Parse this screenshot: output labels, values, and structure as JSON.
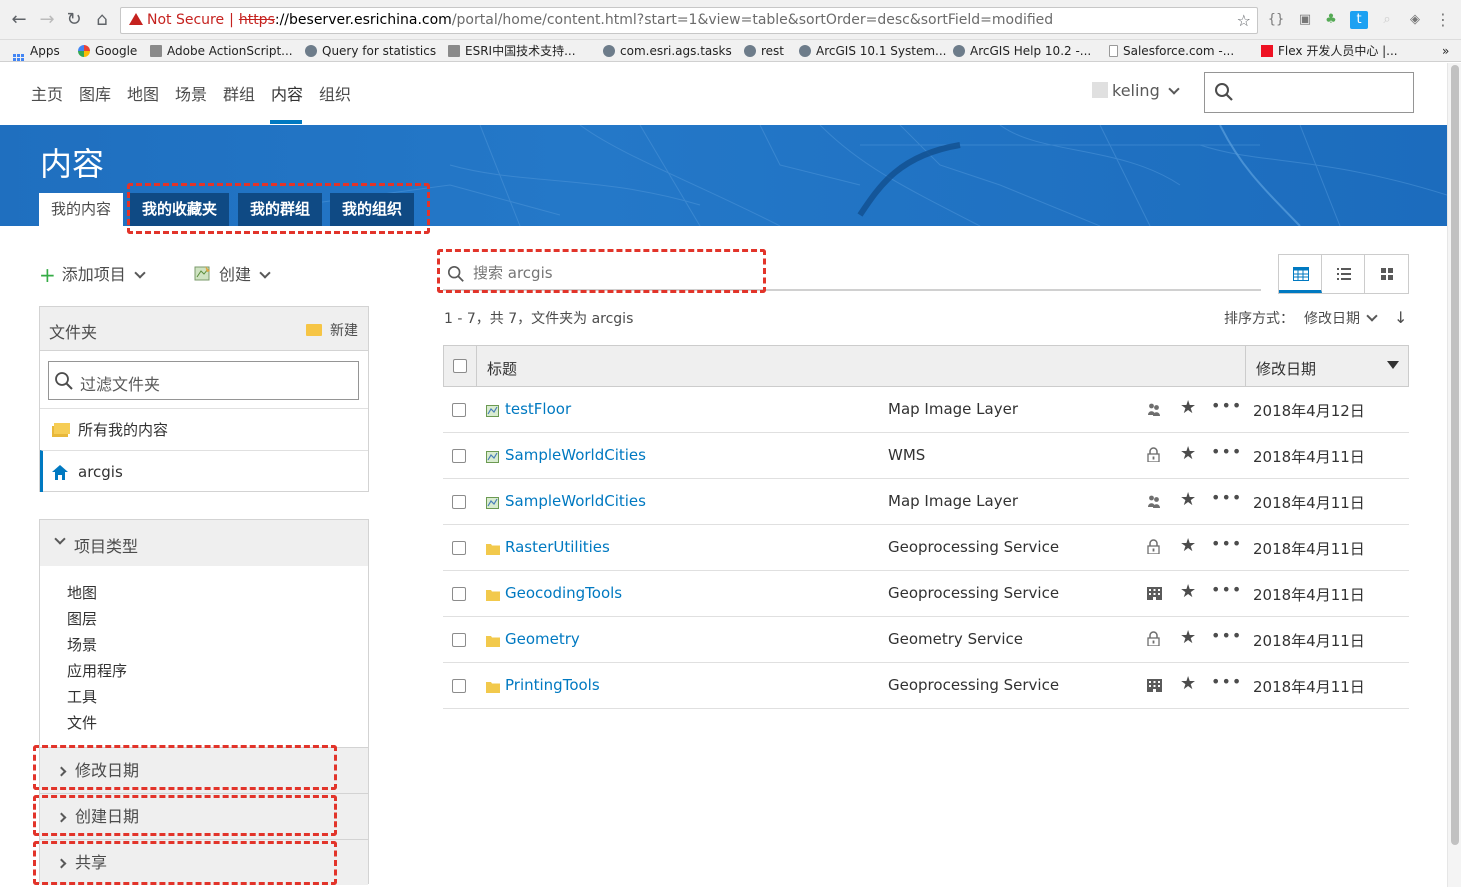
{
  "browser": {
    "not_secure": "Not Secure",
    "url_scheme": "https",
    "url_sep": "|",
    "url_host": "://beserver.esrichina.com",
    "url_path": "/portal/home/content.html?start=1&view=table&sortOrder=desc&sortField=modified",
    "bookmarks": [
      "Apps",
      "Google",
      "Adobe ActionScript...",
      "Query for statistics",
      "ESRI中国技术支持...",
      "com.esri.ags.tasks",
      "rest",
      "ArcGIS 10.1 System...",
      "ArcGIS Help 10.2 -...",
      "Salesforce.com -...",
      "Flex 开发人员中心 |..."
    ],
    "more": "»"
  },
  "nav": {
    "items": [
      "主页",
      "图库",
      "地图",
      "场景",
      "群组",
      "内容",
      "组织"
    ],
    "active": "内容",
    "username": "keling"
  },
  "banner": {
    "title": "内容",
    "tabs": [
      "我的内容",
      "我的收藏夹",
      "我的群组",
      "我的组织"
    ]
  },
  "actions": {
    "add": "添加项目",
    "create": "创建"
  },
  "folders": {
    "header": "文件夹",
    "new": "新建",
    "filter_placeholder": "过滤文件夹",
    "items": [
      "所有我的内容",
      "arcgis"
    ]
  },
  "filters": {
    "type_header": "项目类型",
    "types": [
      "地图",
      "图层",
      "场景",
      "应用程序",
      "工具",
      "文件"
    ],
    "modified": "修改日期",
    "created": "创建日期",
    "shared": "共享"
  },
  "search": {
    "placeholder": "搜索 arcgis"
  },
  "results": {
    "count": "1 - 7，共 7，文件夹为 arcgis",
    "sort_label": "排序方式：",
    "sort_field": "修改日期",
    "col_title": "标题",
    "col_date": "修改日期",
    "rows": [
      {
        "name": "testFloor",
        "type": "Map Image Layer",
        "share": "group",
        "date": "2018年4月12日",
        "icon": "map-image"
      },
      {
        "name": "SampleWorldCities",
        "type": "WMS",
        "share": "private",
        "date": "2018年4月11日",
        "icon": "map-image"
      },
      {
        "name": "SampleWorldCities",
        "type": "Map Image Layer",
        "share": "group",
        "date": "2018年4月11日",
        "icon": "map-image"
      },
      {
        "name": "RasterUtilities",
        "type": "Geoprocessing Service",
        "share": "private",
        "date": "2018年4月11日",
        "icon": "folder"
      },
      {
        "name": "GeocodingTools",
        "type": "Geoprocessing Service",
        "share": "organization",
        "date": "2018年4月11日",
        "icon": "folder"
      },
      {
        "name": "Geometry",
        "type": "Geometry Service",
        "share": "private",
        "date": "2018年4月11日",
        "icon": "folder"
      },
      {
        "name": "PrintingTools",
        "type": "Geoprocessing Service",
        "share": "organization",
        "date": "2018年4月11日",
        "icon": "folder"
      }
    ]
  },
  "colors": {
    "accent": "#0079c1",
    "banner": "#2478c8",
    "tab_dark": "#0f4a84",
    "annotation": "#e2342a",
    "add_green": "#35ac46"
  }
}
